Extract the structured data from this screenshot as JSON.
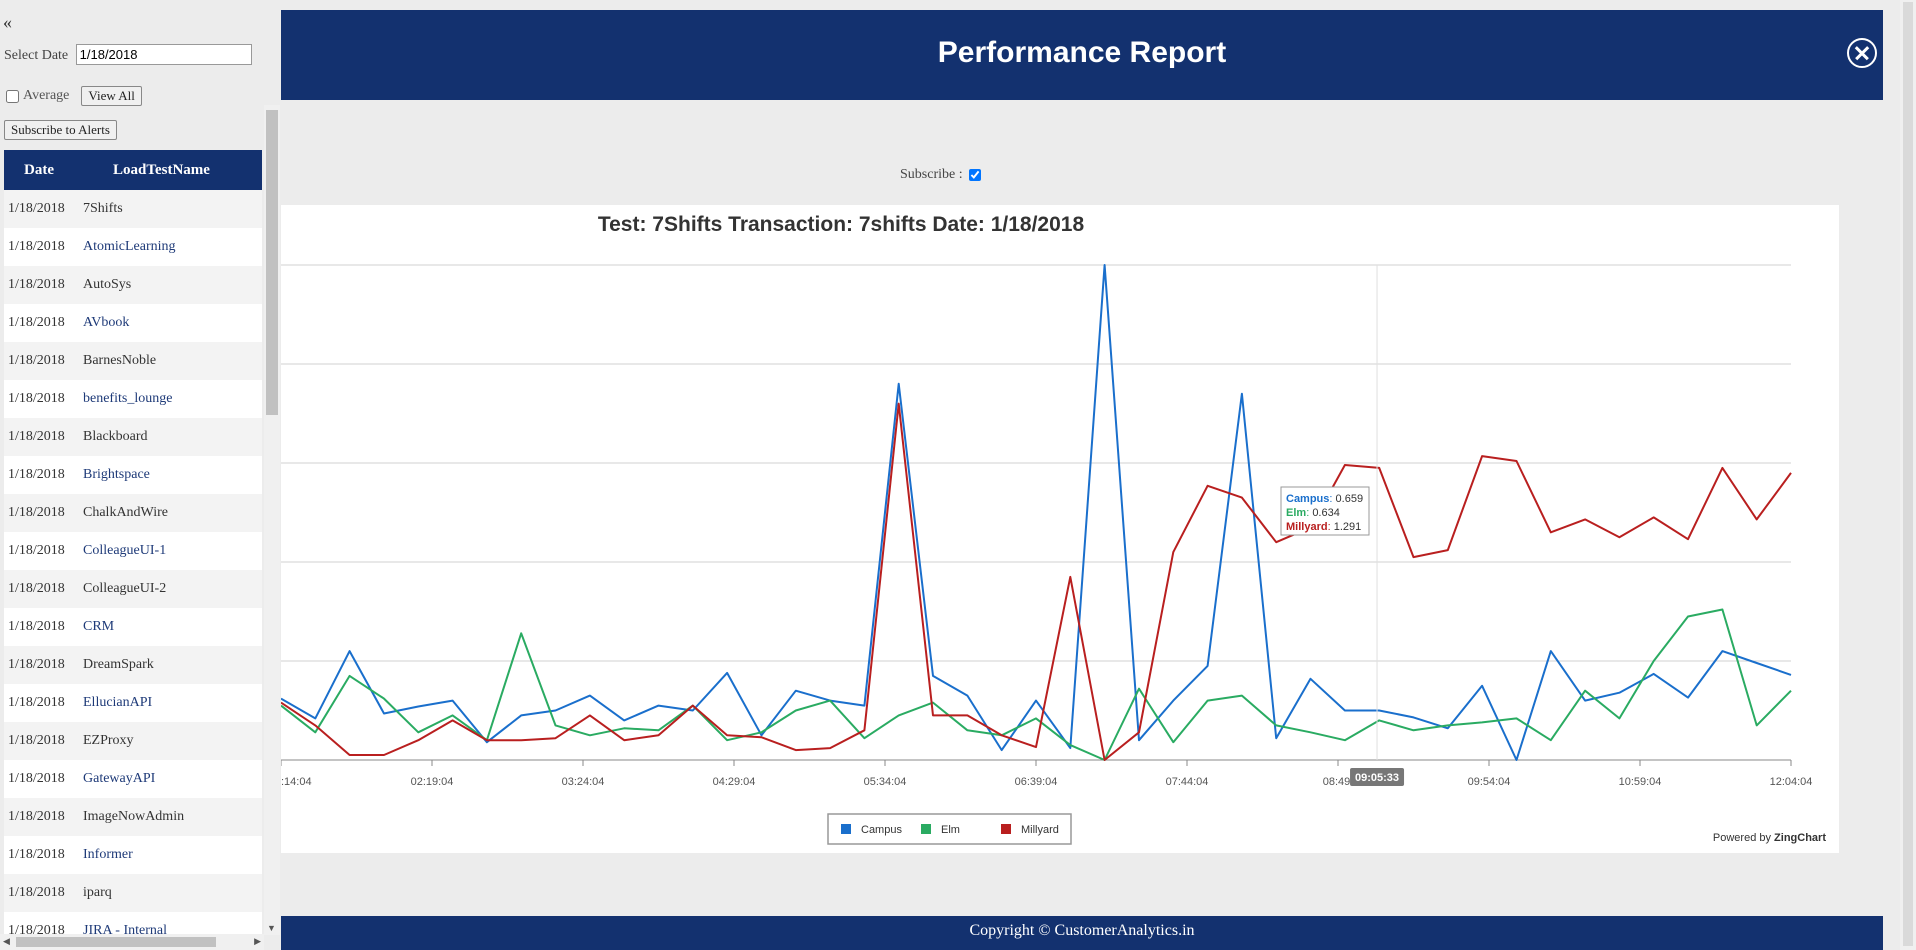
{
  "sidebar": {
    "collapse": "«",
    "select_date_label": "Select Date",
    "select_date_value": "1/18/2018",
    "average_label": "Average",
    "view_all": "View All",
    "subscribe_alerts": "Subscribe to Alerts",
    "table": {
      "headers": [
        "Date",
        "LoadTestName"
      ],
      "rows": [
        {
          "date": "1/18/2018",
          "name": "7Shifts"
        },
        {
          "date": "1/18/2018",
          "name": "AtomicLearning"
        },
        {
          "date": "1/18/2018",
          "name": "AutoSys"
        },
        {
          "date": "1/18/2018",
          "name": "AVbook"
        },
        {
          "date": "1/18/2018",
          "name": "BarnesNoble"
        },
        {
          "date": "1/18/2018",
          "name": "benefits_lounge"
        },
        {
          "date": "1/18/2018",
          "name": "Blackboard"
        },
        {
          "date": "1/18/2018",
          "name": "Brightspace"
        },
        {
          "date": "1/18/2018",
          "name": "ChalkAndWire"
        },
        {
          "date": "1/18/2018",
          "name": "ColleagueUI-1"
        },
        {
          "date": "1/18/2018",
          "name": "ColleagueUI-2"
        },
        {
          "date": "1/18/2018",
          "name": "CRM"
        },
        {
          "date": "1/18/2018",
          "name": "DreamSpark"
        },
        {
          "date": "1/18/2018",
          "name": "EllucianAPI"
        },
        {
          "date": "1/18/2018",
          "name": "EZProxy"
        },
        {
          "date": "1/18/2018",
          "name": "GatewayAPI"
        },
        {
          "date": "1/18/2018",
          "name": "ImageNowAdmin"
        },
        {
          "date": "1/18/2018",
          "name": "Informer"
        },
        {
          "date": "1/18/2018",
          "name": "iparq"
        },
        {
          "date": "1/18/2018",
          "name": "JIRA - Internal"
        }
      ]
    }
  },
  "header": {
    "title": "Performance Report"
  },
  "subscribe": {
    "label": "Subscribe :",
    "checked": true
  },
  "chart_data": {
    "type": "line",
    "title": "Test: 7Shifts Transaction: 7shifts Date: 1/18/2018",
    "x_ticks": [
      ":14:04",
      "02:19:04",
      "03:24:04",
      "04:29:04",
      "05:34:04",
      "06:39:04",
      "07:44:04",
      "08:49:",
      "09:54:04",
      "10:59:04",
      "12:04:04"
    ],
    "crosshair_label": "09:05:33",
    "legend_position": "bottom-center",
    "credit": {
      "prefix": "Powered by ",
      "brand": "ZingChart"
    },
    "ylim": [
      0,
      5
    ],
    "grid": true,
    "tooltip": [
      {
        "name": "Campus",
        "value": "0.659"
      },
      {
        "name": "Elm",
        "value": "0.634"
      },
      {
        "name": "Millyard",
        "value": "1.291"
      }
    ],
    "series": [
      {
        "name": "Campus",
        "color": "#1a6fcc",
        "values": [
          0.62,
          0.42,
          1.1,
          0.47,
          0.54,
          0.6,
          0.18,
          0.45,
          0.5,
          0.65,
          0.4,
          0.55,
          0.5,
          0.88,
          0.25,
          0.7,
          0.6,
          0.55,
          3.8,
          0.85,
          0.65,
          0.1,
          0.6,
          0.12,
          5.0,
          0.2,
          0.6,
          0.95,
          3.7,
          0.22,
          0.82,
          0.5,
          0.5,
          0.43,
          0.32,
          0.75,
          0.0,
          1.1,
          0.6,
          0.68,
          0.87,
          0.63,
          1.1,
          0.98,
          0.86
        ]
      },
      {
        "name": "Elm",
        "color": "#2aab62",
        "values": [
          0.55,
          0.28,
          0.85,
          0.62,
          0.28,
          0.45,
          0.2,
          1.28,
          0.35,
          0.25,
          0.32,
          0.3,
          0.55,
          0.2,
          0.28,
          0.5,
          0.6,
          0.22,
          0.45,
          0.58,
          0.3,
          0.25,
          0.42,
          0.15,
          0.0,
          0.72,
          0.18,
          0.6,
          0.65,
          0.35,
          0.28,
          0.2,
          0.4,
          0.3,
          0.35,
          0.38,
          0.42,
          0.2,
          0.7,
          0.42,
          1.0,
          1.45,
          1.52,
          0.35,
          0.7
        ]
      },
      {
        "name": "Millyard",
        "color": "#b91f1f",
        "values": [
          0.58,
          0.35,
          0.05,
          0.05,
          0.2,
          0.4,
          0.2,
          0.2,
          0.22,
          0.45,
          0.2,
          0.25,
          0.55,
          0.25,
          0.23,
          0.1,
          0.12,
          0.3,
          3.6,
          0.45,
          0.45,
          0.25,
          0.13,
          1.85,
          0.0,
          0.28,
          2.1,
          2.77,
          2.65,
          2.2,
          2.35,
          2.98,
          2.95,
          2.05,
          2.12,
          3.07,
          3.02,
          2.3,
          2.43,
          2.25,
          2.45,
          2.23,
          2.95,
          2.43,
          2.9
        ]
      }
    ]
  },
  "footer": {
    "text": "Copyright © CustomerAnalytics.in"
  }
}
